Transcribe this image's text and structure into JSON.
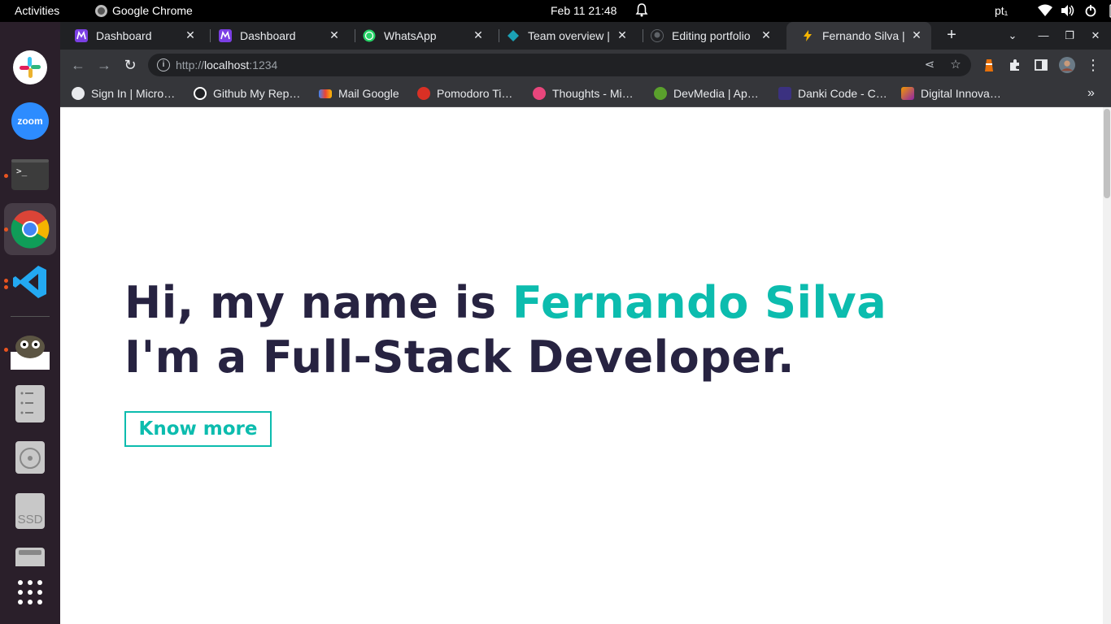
{
  "system": {
    "activities": "Activities",
    "active_app": "Google Chrome",
    "clock": "Feb 11  21:48",
    "input_lang": "pt₁"
  },
  "dock": {
    "items": [
      "slack-icon",
      "zoom-icon",
      "terminal-icon",
      "chrome-icon",
      "vscode-icon",
      "gimp-icon",
      "files-icon",
      "disc-icon",
      "ssd-drive-icon",
      "drive-icon",
      "app-grid-icon"
    ],
    "zoom_label": "zoom",
    "ssd_label": "SSD"
  },
  "tabs": [
    {
      "title": "Dashboard",
      "favicon": "dashboard-favicon"
    },
    {
      "title": "Dashboard",
      "favicon": "dashboard-favicon"
    },
    {
      "title": "WhatsApp",
      "favicon": "whatsapp-favicon"
    },
    {
      "title": "Team overview |",
      "favicon": "diamond-favicon"
    },
    {
      "title": "Editing portfolio",
      "favicon": "github-favicon"
    },
    {
      "title": "Fernando Silva |",
      "favicon": "bolt-favicon",
      "active": true
    }
  ],
  "omnibox": {
    "url_prefix": "http://",
    "url_host": "localhost",
    "url_port": ":1234"
  },
  "bookmarks": [
    {
      "label": "Sign In | Micro…",
      "color": "#e8eaed"
    },
    {
      "label": "Github My Rep…",
      "color": "#ffffff"
    },
    {
      "label": "Mail Google",
      "color": "#ea4335"
    },
    {
      "label": "Pomodoro Ti…",
      "color": "#d93025"
    },
    {
      "label": "Thoughts - Mi…",
      "color": "#e8467c"
    },
    {
      "label": "DevMedia | Ap…",
      "color": "#5aa02c"
    },
    {
      "label": "Danki Code - C…",
      "color": "#6b5bd6"
    },
    {
      "label": "Digital Innova…",
      "color": "#f29900"
    }
  ],
  "hero": {
    "line1_prefix": "Hi, my name is ",
    "line1_name": "Fernando Silva",
    "line2": "I'm a Full-Stack Developer.",
    "button": "Know more"
  },
  "colors": {
    "accent": "#0cbcae",
    "text_dark": "#272341"
  }
}
